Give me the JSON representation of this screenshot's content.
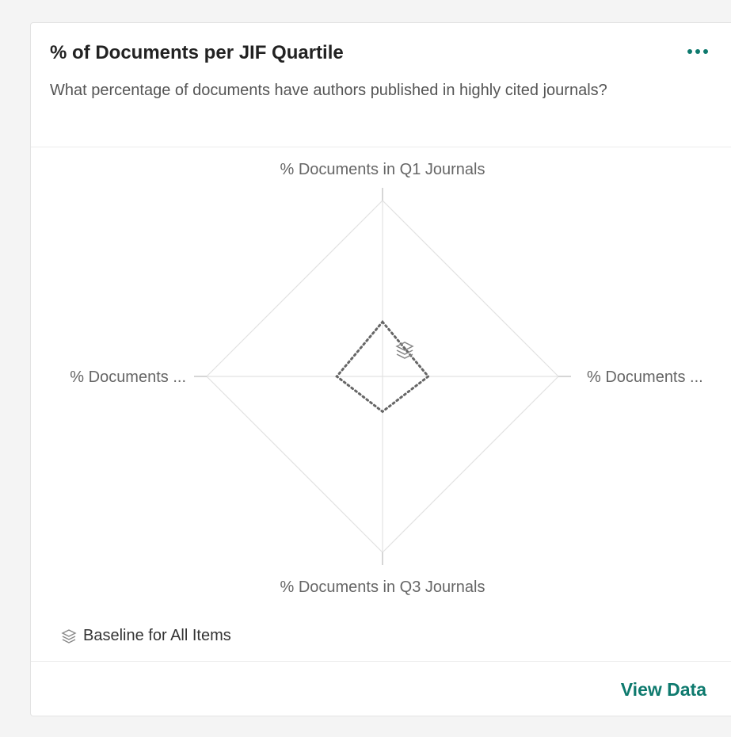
{
  "card": {
    "title": "% of Documents per JIF Quartile",
    "subtitle": "What percentage of documents have authors published in highly cited journals?",
    "more_icon": "more-horizontal-icon",
    "view_data_label": "View Data"
  },
  "legend": {
    "label": "Baseline for All Items",
    "icon": "layers-icon"
  },
  "colors": {
    "accent": "#0e7a6e",
    "grid": "#e2e2e2",
    "baseline": "#666666"
  },
  "chart_data": {
    "type": "radar",
    "axes": [
      {
        "label": "% Documents in Q1 Journals"
      },
      {
        "label": "% Documents ..."
      },
      {
        "label": "% Documents in Q3 Journals"
      },
      {
        "label": "% Documents ..."
      }
    ],
    "range": [
      0,
      100
    ],
    "grid": true,
    "series": [
      {
        "name": "Baseline for All Items",
        "style": "dotted",
        "values": [
          31,
          26,
          20,
          26
        ]
      }
    ],
    "legend_position": "bottom-left"
  }
}
